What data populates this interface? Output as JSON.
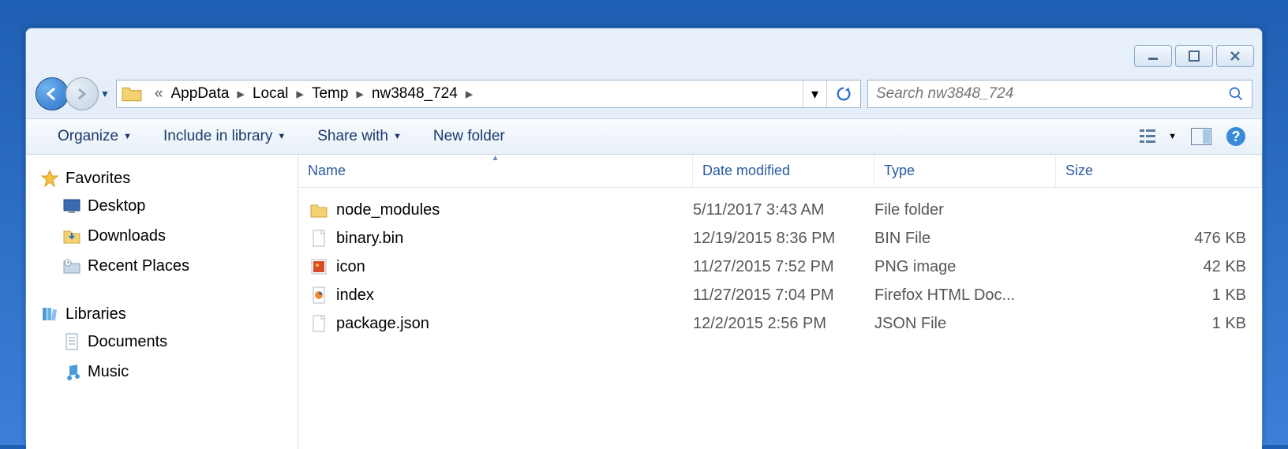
{
  "breadcrumbs": [
    "AppData",
    "Local",
    "Temp",
    "nw3848_724"
  ],
  "search": {
    "placeholder": "Search nw3848_724"
  },
  "toolbar": {
    "organize": "Organize",
    "include": "Include in library",
    "share": "Share with",
    "new_folder": "New folder"
  },
  "columns": {
    "name": "Name",
    "date": "Date modified",
    "type": "Type",
    "size": "Size"
  },
  "sidebar": {
    "favorites": "Favorites",
    "desktop": "Desktop",
    "downloads": "Downloads",
    "recent": "Recent Places",
    "libraries": "Libraries",
    "documents": "Documents",
    "music": "Music"
  },
  "files": [
    {
      "name": "node_modules",
      "date": "5/11/2017 3:43 AM",
      "type": "File folder",
      "size": ""
    },
    {
      "name": "binary.bin",
      "date": "12/19/2015 8:36 PM",
      "type": "BIN File",
      "size": "476 KB"
    },
    {
      "name": "icon",
      "date": "11/27/2015 7:52 PM",
      "type": "PNG image",
      "size": "42 KB"
    },
    {
      "name": "index",
      "date": "11/27/2015 7:04 PM",
      "type": "Firefox HTML Doc...",
      "size": "1 KB"
    },
    {
      "name": "package.json",
      "date": "12/2/2015 2:56 PM",
      "type": "JSON File",
      "size": "1 KB"
    }
  ]
}
